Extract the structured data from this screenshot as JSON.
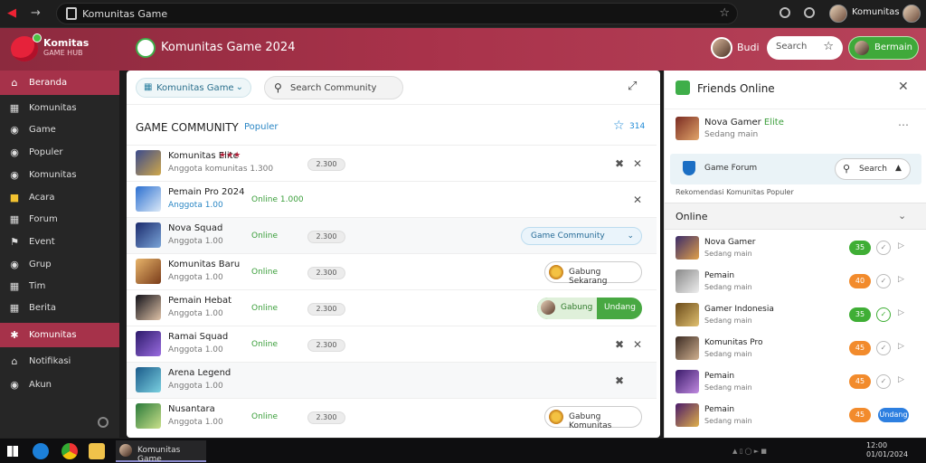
{
  "browser": {
    "url": "Komunitas Game",
    "profile_name": "Komunitas"
  },
  "header": {
    "brand_name": "Komitas",
    "brand_sub": "GAME HUB",
    "title": "Komunitas Game 2024",
    "user_name": "Budi",
    "search_label": "Search",
    "action_button": "Bermain"
  },
  "sidebar": {
    "items": [
      {
        "label": "Beranda",
        "icon": "home-icon"
      },
      {
        "label": "Komunitas",
        "icon": "grid-icon"
      },
      {
        "label": "Game",
        "icon": "gamepad-icon"
      },
      {
        "label": "Populer",
        "icon": "flame-icon"
      },
      {
        "label": "Komunitas",
        "icon": "users-icon"
      },
      {
        "label": "Acara",
        "icon": "calendar-icon"
      },
      {
        "label": "Forum",
        "icon": "forum-icon"
      },
      {
        "label": "Event",
        "icon": "flag-icon"
      },
      {
        "label": "Grup",
        "icon": "group-icon"
      },
      {
        "label": "Tim",
        "icon": "team-icon"
      },
      {
        "label": "Berita",
        "icon": "news-icon"
      },
      {
        "label": "Komunitas",
        "icon": "star-icon"
      },
      {
        "label": "Notifikasi",
        "icon": "bell-icon"
      },
      {
        "label": "Akun",
        "icon": "user-icon"
      }
    ]
  },
  "main": {
    "tab_label": "Komunitas Game",
    "search_label": "Search Community",
    "section_title": "GAME COMMUNITY",
    "section_sub": "Populer",
    "section_count": "314",
    "rows": [
      {
        "name": "Komunitas Elite",
        "meta": "Anggota komunitas 1.300",
        "status": "",
        "chip": "2.300",
        "control": "actions"
      },
      {
        "name": "Pemain Pro 2024",
        "meta": "Anggota 1.00",
        "status": "Online 1.000",
        "chip": "",
        "control": "actions-single"
      },
      {
        "name": "Nova Squad",
        "meta": "Anggota 1.00",
        "status": "Online",
        "chip": "2.300",
        "control": "select",
        "select_label": "Game Community"
      },
      {
        "name": "Komunitas Baru",
        "meta": "Anggota 1.00",
        "status": "Online",
        "chip": "2.300",
        "control": "join",
        "button_label": "Gabung Sekarang"
      },
      {
        "name": "Pemain Hebat",
        "meta": "Anggota 1.00",
        "status": "Online",
        "chip": "2.300",
        "control": "split",
        "left_label": "Gabung",
        "right_label": "Undang"
      },
      {
        "name": "Ramai Squad",
        "meta": "Anggota 1.00",
        "status": "Online",
        "chip": "2.300",
        "control": "actions"
      },
      {
        "name": "Arena Legend",
        "meta": "Anggota 1.00",
        "status": "",
        "chip": "",
        "control": "actions-single"
      },
      {
        "name": "Nusantara",
        "meta": "Anggota 1.00",
        "status": "Online",
        "chip": "2.300",
        "control": "join",
        "button_label": "Gabung Komunitas"
      }
    ]
  },
  "right_panel": {
    "title": "Friends Online",
    "user": {
      "name": "Nova Gamer",
      "tag": "Elite",
      "status": "Sedang main"
    },
    "community_label": "Game Forum",
    "search_label": "Search",
    "note": "Rekomendasi Komunitas Populer",
    "online_header": "Online",
    "friends": [
      {
        "name": "Nova Gamer",
        "status": "Sedang main",
        "badge": "35",
        "badge_color": "green",
        "extra": "circle"
      },
      {
        "name": "Pemain",
        "status": "Sedang main",
        "badge": "40",
        "badge_color": "orange",
        "extra": "play"
      },
      {
        "name": "Gamer Indonesia",
        "status": "Sedang main",
        "badge": "35",
        "badge_color": "green",
        "extra": "circle-green"
      },
      {
        "name": "Komunitas Pro",
        "status": "Sedang main",
        "badge": "45",
        "badge_color": "orange",
        "extra": "play"
      },
      {
        "name": "Pemain",
        "status": "Sedang main",
        "badge": "45",
        "badge_color": "orange",
        "extra": "play"
      },
      {
        "name": "Pemain",
        "status": "Sedang main",
        "badge": "45",
        "badge_color": "orange",
        "extra": "blue",
        "blue_label": "Undang"
      }
    ]
  },
  "taskbar": {
    "task_label": "Komunitas Game",
    "clock_time": "12:00",
    "clock_date": "01/01/2024"
  },
  "colors": {
    "header_accent": "#a8324a",
    "active_sidebar": "#a6324a",
    "success": "#3fae49",
    "link": "#2a86c4"
  }
}
